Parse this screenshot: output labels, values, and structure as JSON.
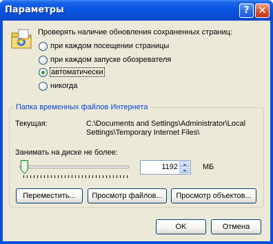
{
  "window": {
    "title": "Параметры",
    "help_glyph": "?",
    "close_glyph": "✕"
  },
  "check_updates": {
    "prompt": "Проверять наличие обновления сохраненных страниц:",
    "options": [
      {
        "label": "при каждом посещении страницы",
        "selected": false
      },
      {
        "label": "при каждом запуске обозревателя",
        "selected": false
      },
      {
        "label": "автоматически",
        "selected": true
      },
      {
        "label": "никогда",
        "selected": false
      }
    ]
  },
  "temp_folder": {
    "group_title": "Папка временных файлов Интернета",
    "current_label": "Текущая:",
    "current_path": "C:\\Documents and Settings\\Administrator\\Local Settings\\Temporary Internet Files\\",
    "disk_label": "Занимать на диске не более:",
    "size_value": "1192",
    "size_unit": "МБ",
    "slider_fraction": 0.02
  },
  "buttons": {
    "move": "Переместить...",
    "view_files": "Просмотр файлов...",
    "view_objects": "Просмотр объектов...",
    "ok": "OK",
    "cancel": "Отмена"
  },
  "colors": {
    "titlebar": "#0954e0",
    "dialog_bg": "#ece9d8",
    "group_title": "#0046d5",
    "radio_check": "#21a121"
  }
}
